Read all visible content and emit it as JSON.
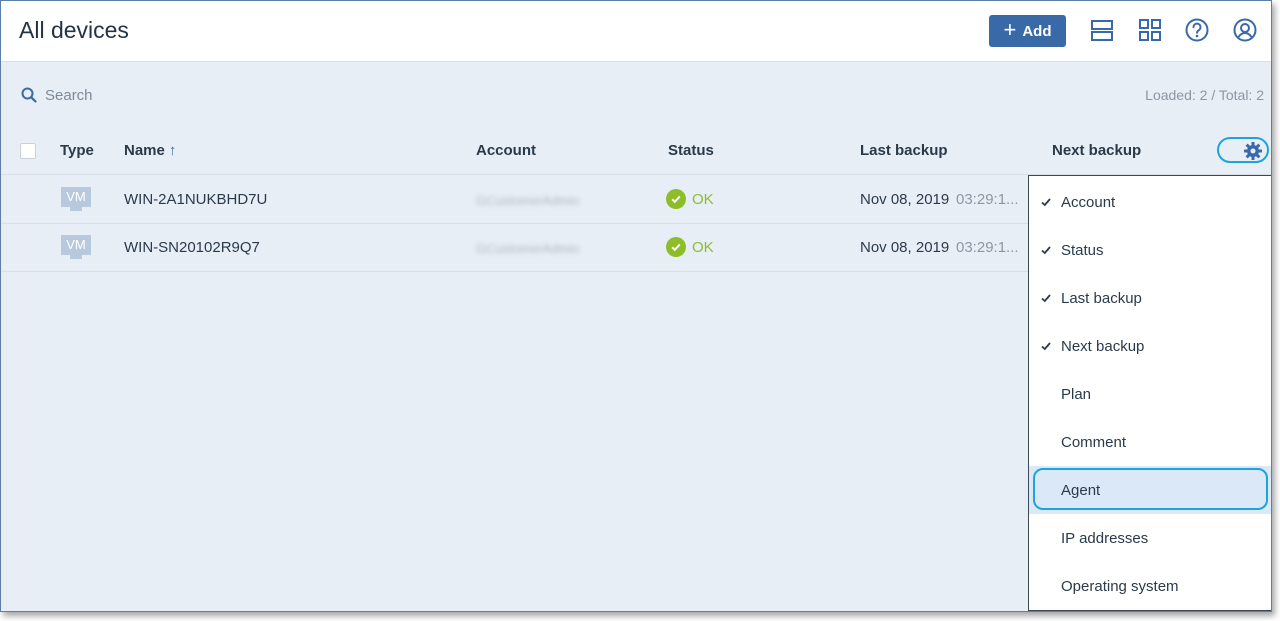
{
  "header": {
    "title": "All devices",
    "add_label": "Add",
    "icons": [
      "list-view-icon",
      "grid-view-icon",
      "help-icon",
      "account-icon"
    ]
  },
  "search": {
    "placeholder": "Search"
  },
  "summary": {
    "loaded": "Loaded: 2 / Total: 2"
  },
  "columns": {
    "type": "Type",
    "name": "Name",
    "account": "Account",
    "status": "Status",
    "last_backup": "Last backup",
    "next_backup": "Next backup"
  },
  "rows": [
    {
      "type": "VM",
      "name": "WIN-2A1NUKBHD7U",
      "account": "GCustomerAdmin",
      "status": "OK",
      "last_backup_date": "Nov 08, 2019",
      "last_backup_time": "03:29:1..."
    },
    {
      "type": "VM",
      "name": "WIN-SN20102R9Q7",
      "account": "GCustomerAdmin",
      "status": "OK",
      "last_backup_date": "Nov 08, 2019",
      "last_backup_time": "03:29:1..."
    }
  ],
  "column_menu": {
    "items": [
      {
        "label": "Account",
        "checked": true
      },
      {
        "label": "Status",
        "checked": true
      },
      {
        "label": "Last backup",
        "checked": true
      },
      {
        "label": "Next backup",
        "checked": true
      },
      {
        "label": "Plan",
        "checked": false
      },
      {
        "label": "Comment",
        "checked": false
      },
      {
        "label": "Agent",
        "checked": false,
        "highlighted": true
      },
      {
        "label": "IP addresses",
        "checked": false
      },
      {
        "label": "Operating system",
        "checked": false
      }
    ]
  },
  "colors": {
    "accent": "#3a69a8",
    "focus_ring": "#1fa3d9",
    "ok": "#8ebd2a",
    "background": "#e8eef6"
  }
}
